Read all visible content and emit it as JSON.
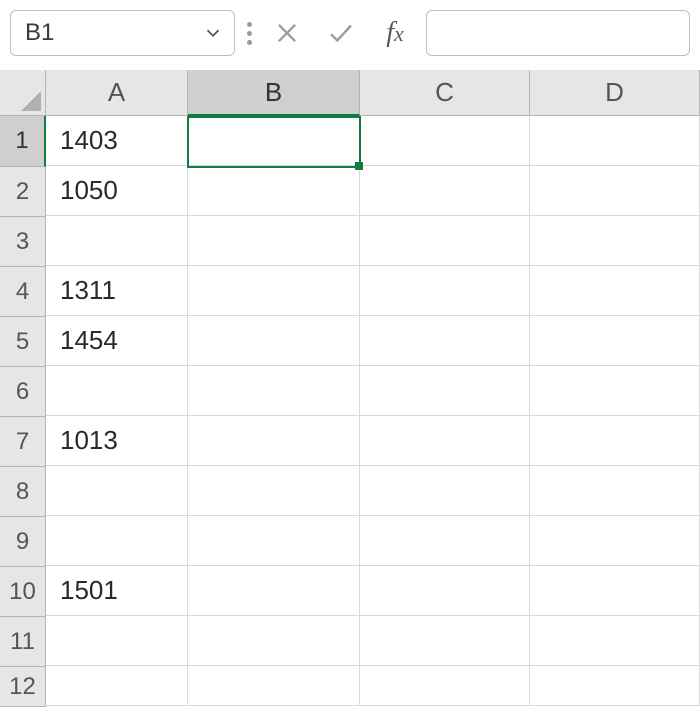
{
  "nameBox": {
    "value": "B1"
  },
  "formulaBar": {
    "value": ""
  },
  "columns": [
    "A",
    "B",
    "C",
    "D"
  ],
  "rows": [
    "1",
    "2",
    "3",
    "4",
    "5",
    "6",
    "7",
    "8",
    "9",
    "10",
    "11",
    "12"
  ],
  "selectedCell": "B1",
  "cells": {
    "A1": "1403",
    "A2": "1050",
    "A3": "",
    "A4": "1311",
    "A5": "1454",
    "A6": "",
    "A7": "1013",
    "A8": "",
    "A9": "",
    "A10": "1501",
    "A11": "",
    "A12": ""
  },
  "icons": {
    "chevron": "chevron-down",
    "cancel": "x",
    "confirm": "check",
    "fx": "fx"
  }
}
